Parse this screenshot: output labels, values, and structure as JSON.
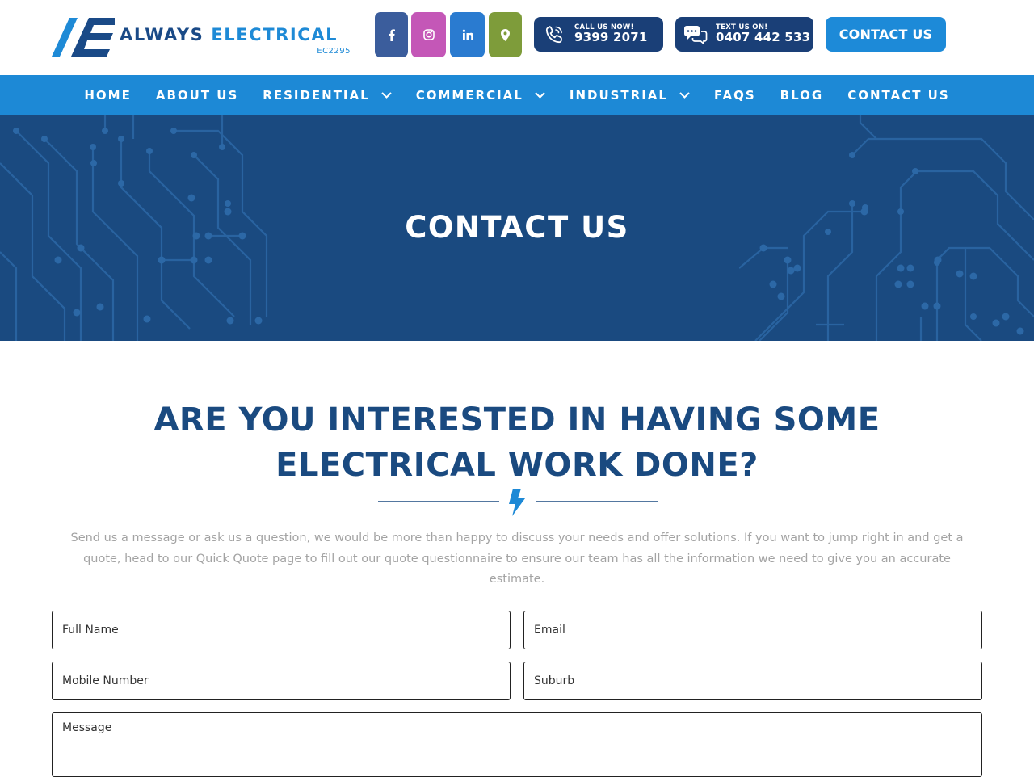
{
  "brand": {
    "name_part1": "ALWAYS ",
    "name_part2": "ELECTRICAL",
    "license": "EC2295",
    "colors": {
      "navy": "#1a4a80",
      "blue": "#1d89d6",
      "dark_pill": "#1a3f77"
    }
  },
  "header": {
    "social": [
      {
        "name": "facebook-icon",
        "color": "#3b5d9c"
      },
      {
        "name": "instagram-icon",
        "color": "#c457b7"
      },
      {
        "name": "linkedin-icon",
        "color": "#2a7bd0"
      },
      {
        "name": "map-pin-icon",
        "color": "#7e9c3a"
      }
    ],
    "call": {
      "label": "CALL US NOW!",
      "number": "9399 2071",
      "icon": "phone-icon"
    },
    "text": {
      "label": "TEXT US ON!",
      "number": "0407 442 533",
      "icon": "chat-icon"
    },
    "contact_button": "CONTACT US"
  },
  "nav": {
    "items": [
      {
        "label": "HOME"
      },
      {
        "label": "ABOUT US"
      },
      {
        "label": "RESIDENTIAL",
        "dropdown": true
      },
      {
        "label": "COMMERCIAL",
        "dropdown": true
      },
      {
        "label": "INDUSTRIAL",
        "dropdown": true
      },
      {
        "label": "FAQS"
      },
      {
        "label": "BLOG"
      },
      {
        "label": "CONTACT US"
      }
    ]
  },
  "hero": {
    "title": "CONTACT US"
  },
  "main": {
    "headline": "ARE YOU INTERESTED IN HAVING SOME ELECTRICAL WORK DONE?",
    "divider_icon": "lightning-bolt-icon",
    "intro": "Send us a message or ask us a question, we would be more than happy to discuss your needs and offer solutions. If you want to jump right in and get a quote, head to our Quick Quote page to fill out our quote questionnaire to ensure our team has all the information we need to give you an accurate estimate."
  },
  "form": {
    "full_name_placeholder": "Full Name",
    "email_placeholder": "Email",
    "mobile_placeholder": "Mobile Number",
    "suburb_placeholder": "Suburb",
    "message_placeholder": "Message"
  }
}
